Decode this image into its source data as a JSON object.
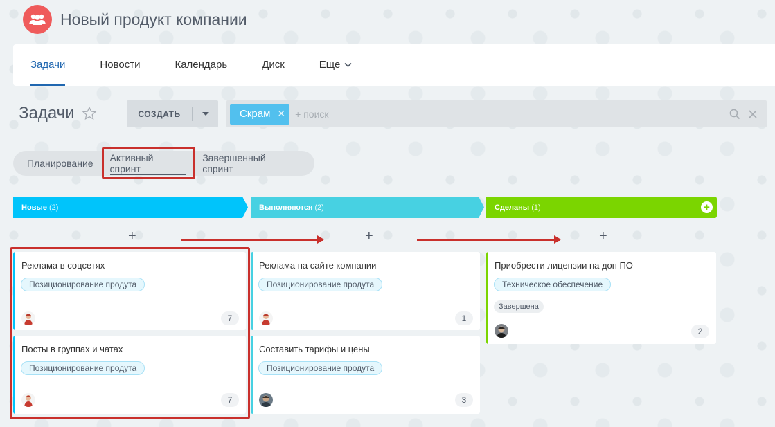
{
  "app": {
    "title": "Новый продукт компании"
  },
  "nav": {
    "tabs": [
      "Задачи",
      "Новости",
      "Календарь",
      "Диск"
    ],
    "more_label": "Еще"
  },
  "page": {
    "title": "Задачи"
  },
  "toolbar": {
    "create_label": "СОЗДАТЬ",
    "filter_chip": "Скрам",
    "search_placeholder": "+ поиск"
  },
  "sprint_tabs": [
    "Планирование",
    "Активный спринт",
    "Завершенный спринт"
  ],
  "columns": [
    {
      "name": "Новые",
      "count": "(2)",
      "color": "#00c4fb"
    },
    {
      "name": "Выполняются",
      "count": "(2)",
      "color": "#47d1e2"
    },
    {
      "name": "Сделаны",
      "count": "(1)",
      "color": "#7bd500"
    }
  ],
  "add_symbol": "+",
  "cards": [
    {
      "title": "Реклама в соцсетях",
      "tag": "Позиционирование продута",
      "count": "7"
    },
    {
      "title": "Посты в группах и чатах",
      "tag": "Позиционирование продута",
      "count": "7"
    },
    {
      "title": "Реклама на сайте компании",
      "tag": "Позиционирование продута",
      "count": "1"
    },
    {
      "title": "Составить тарифы и цены",
      "tag": "Позиционирование продута",
      "count": "3"
    },
    {
      "title": "Приобрести лицензии на доп ПО",
      "tag": "Техническое обеспечение",
      "status": "Завершена",
      "count": "2"
    }
  ]
}
